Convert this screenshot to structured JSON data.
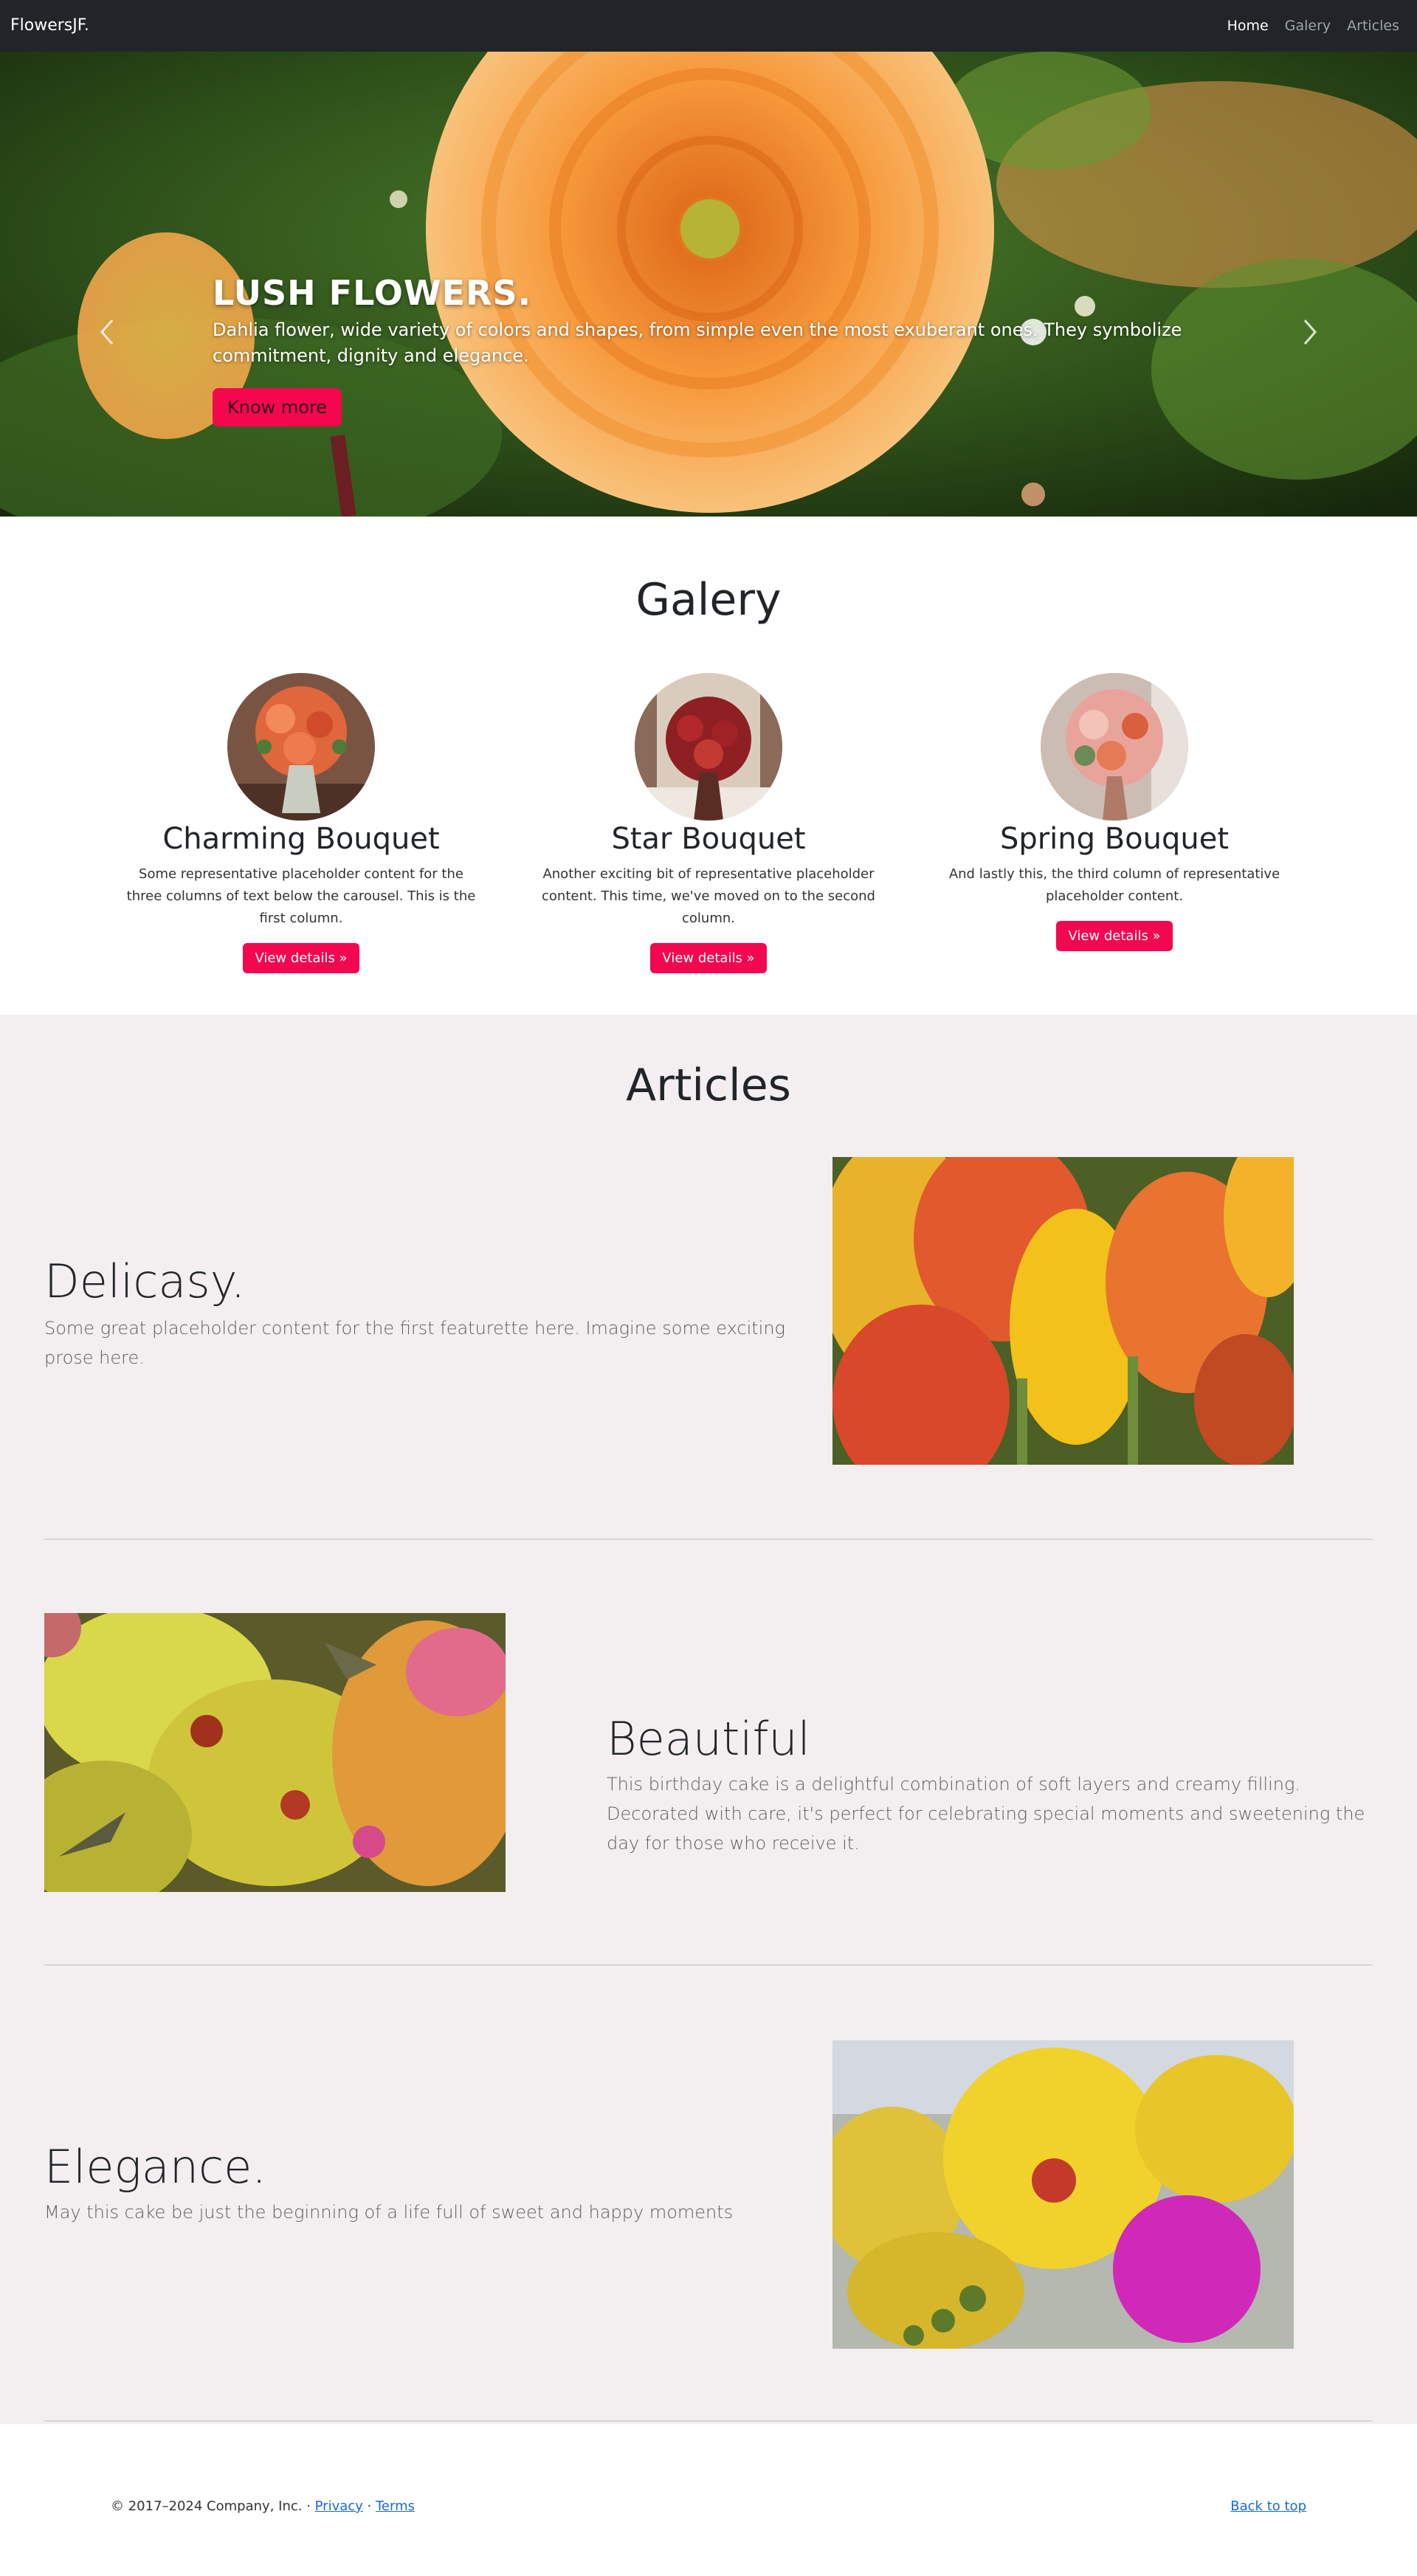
{
  "nav": {
    "brand": "FlowersJF.",
    "links": [
      "Home",
      "Galery",
      "Articles"
    ]
  },
  "hero": {
    "title": "LUSH FLOWERS.",
    "text": "Dahlia flower, wide variety of colors and shapes, from simple even the most exuberant ones. They symbolize commitment, dignity and elegance.",
    "button": "Know more",
    "prev_icon": "chevron-left-icon",
    "next_icon": "chevron-right-icon",
    "slides": 3,
    "active_slide": 1
  },
  "gallery": {
    "title": "Galery",
    "cards": [
      {
        "title": "Charming Bouquet",
        "text": "Some representative placeholder content for the three columns of text below the carousel. This is the first column.",
        "button": "View details »"
      },
      {
        "title": "Star Bouquet",
        "text": "Another exciting bit of representative placeholder content. This time, we've moved on to the second column.",
        "button": "View details »"
      },
      {
        "title": "Spring Bouquet",
        "text": "And lastly this, the third column of representative placeholder content.",
        "button": "View details »"
      }
    ]
  },
  "articles": {
    "title": "Articles",
    "features": [
      {
        "heading": "Delicasy.",
        "text": "Some great placeholder content for the first featurette here. Imagine some exciting prose here."
      },
      {
        "heading": "Beautiful",
        "text": "This birthday cake is a delightful combination of soft layers and creamy filling. Decorated with care, it's perfect for celebrating special moments and sweetening the day for those who receive it."
      },
      {
        "heading": "Elegance.",
        "text": "May this cake be just the beginning of a life full of sweet and happy moments"
      }
    ]
  },
  "footer": {
    "copyright": "© 2017–2024 Company, Inc. · ",
    "privacy": "Privacy",
    "separator": " · ",
    "terms": "Terms",
    "back_to_top": "Back to top"
  },
  "colors": {
    "accent": "#f3074f",
    "navbar": "#212529",
    "articles_bg": "#f3eef0",
    "link": "#1a6bd8"
  }
}
